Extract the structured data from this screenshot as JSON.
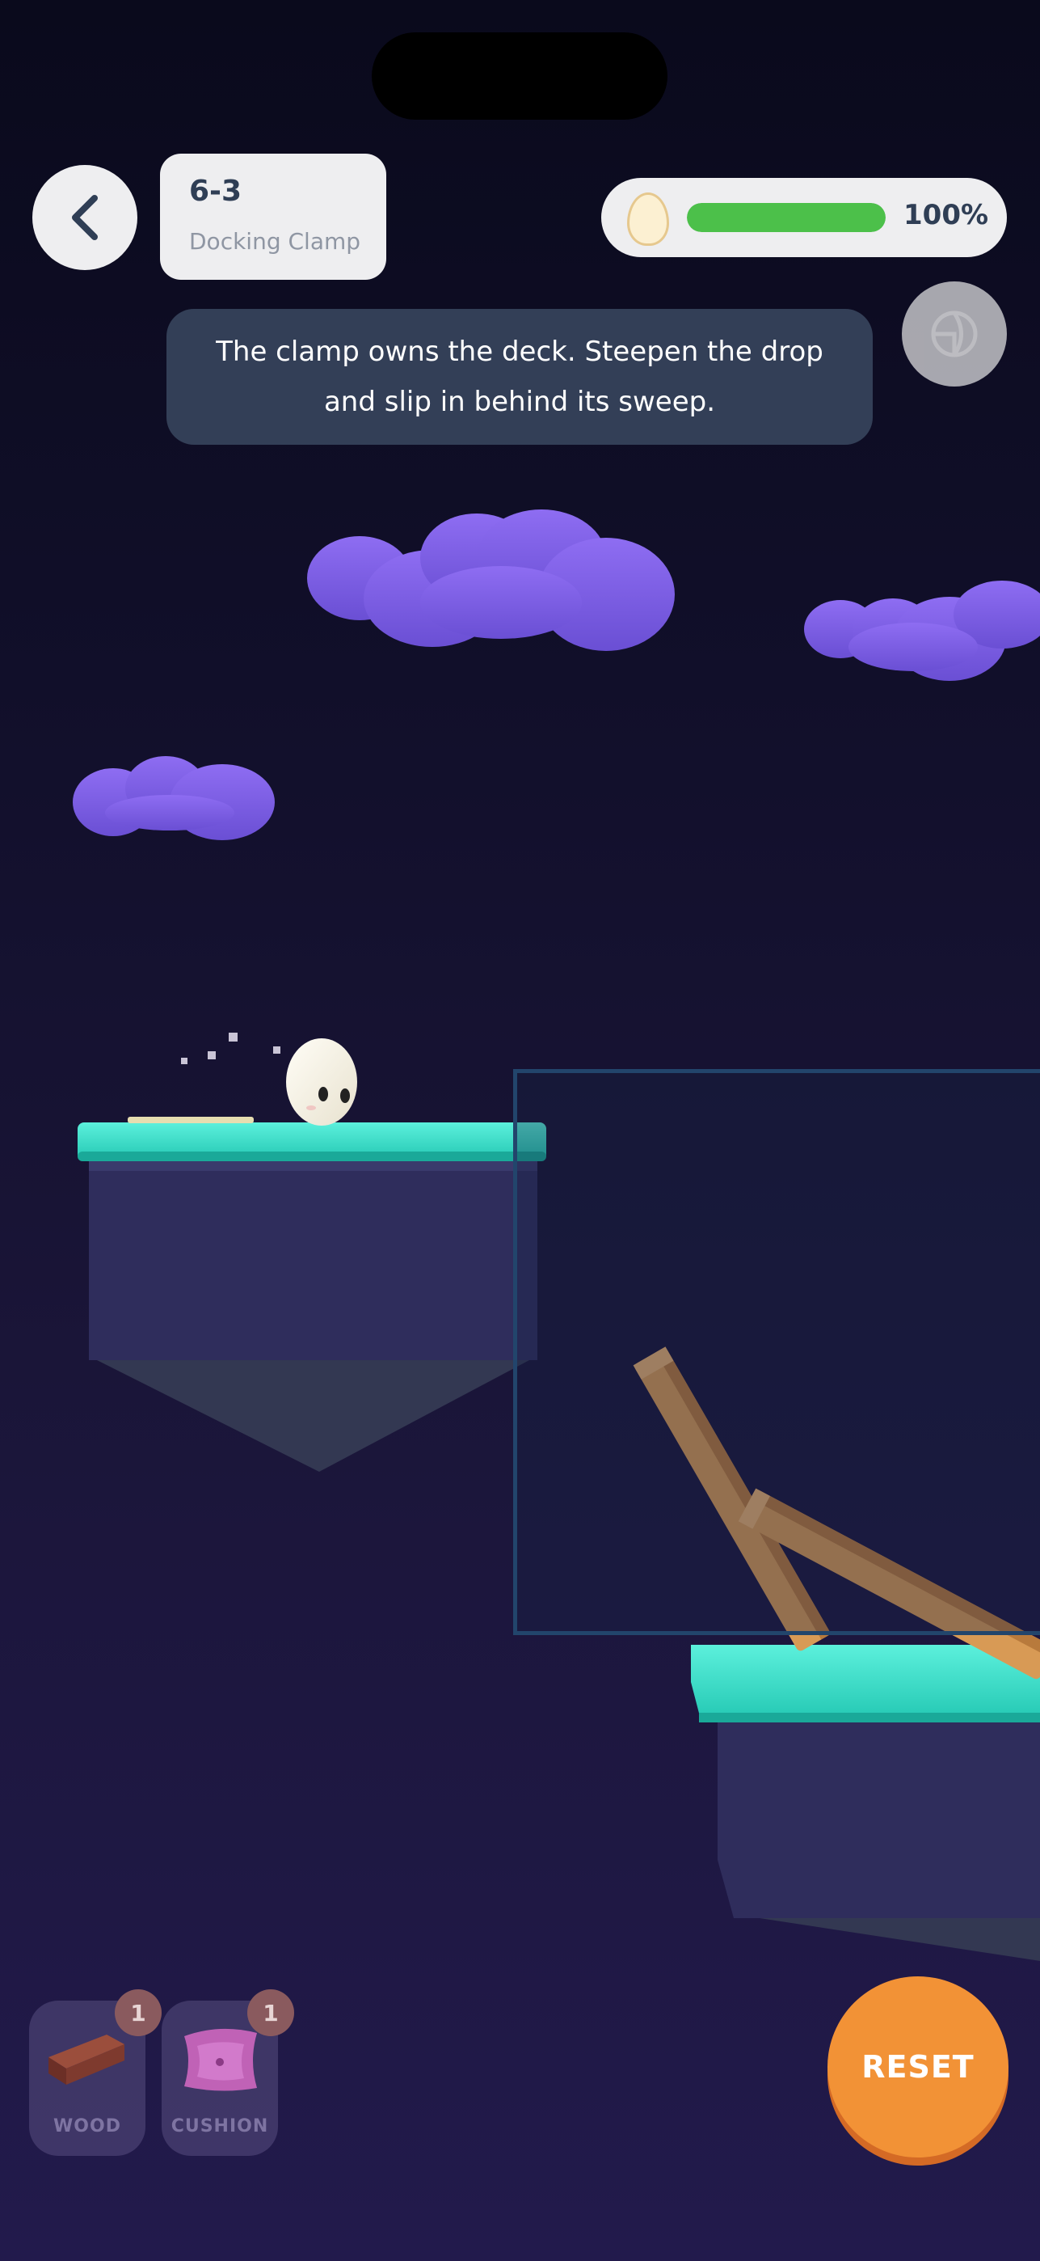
{
  "header": {
    "back_icon": "chevron-left-icon",
    "level_id": "6-3",
    "level_name": "Docking Clamp",
    "progress_percent": 100,
    "progress_label": "100%",
    "egg_icon": "egg-icon",
    "globe_icon": "globe-icon"
  },
  "hint": {
    "text": "The clamp owns the deck. Steepen the drop and slip in behind its sweep."
  },
  "inventory": [
    {
      "label": "WOOD",
      "count": "1",
      "icon": "wood-plank-icon"
    },
    {
      "label": "CUSHION",
      "count": "1",
      "icon": "cushion-icon"
    }
  ],
  "reset": {
    "label": "RESET"
  },
  "colors": {
    "platform_top": "#3fe1cc",
    "platform_body": "#2f2d5c",
    "cloud": "#7c5ce0",
    "progress_fill": "#4cc04a",
    "reset": "#f29236",
    "plank": "#d89a55"
  }
}
